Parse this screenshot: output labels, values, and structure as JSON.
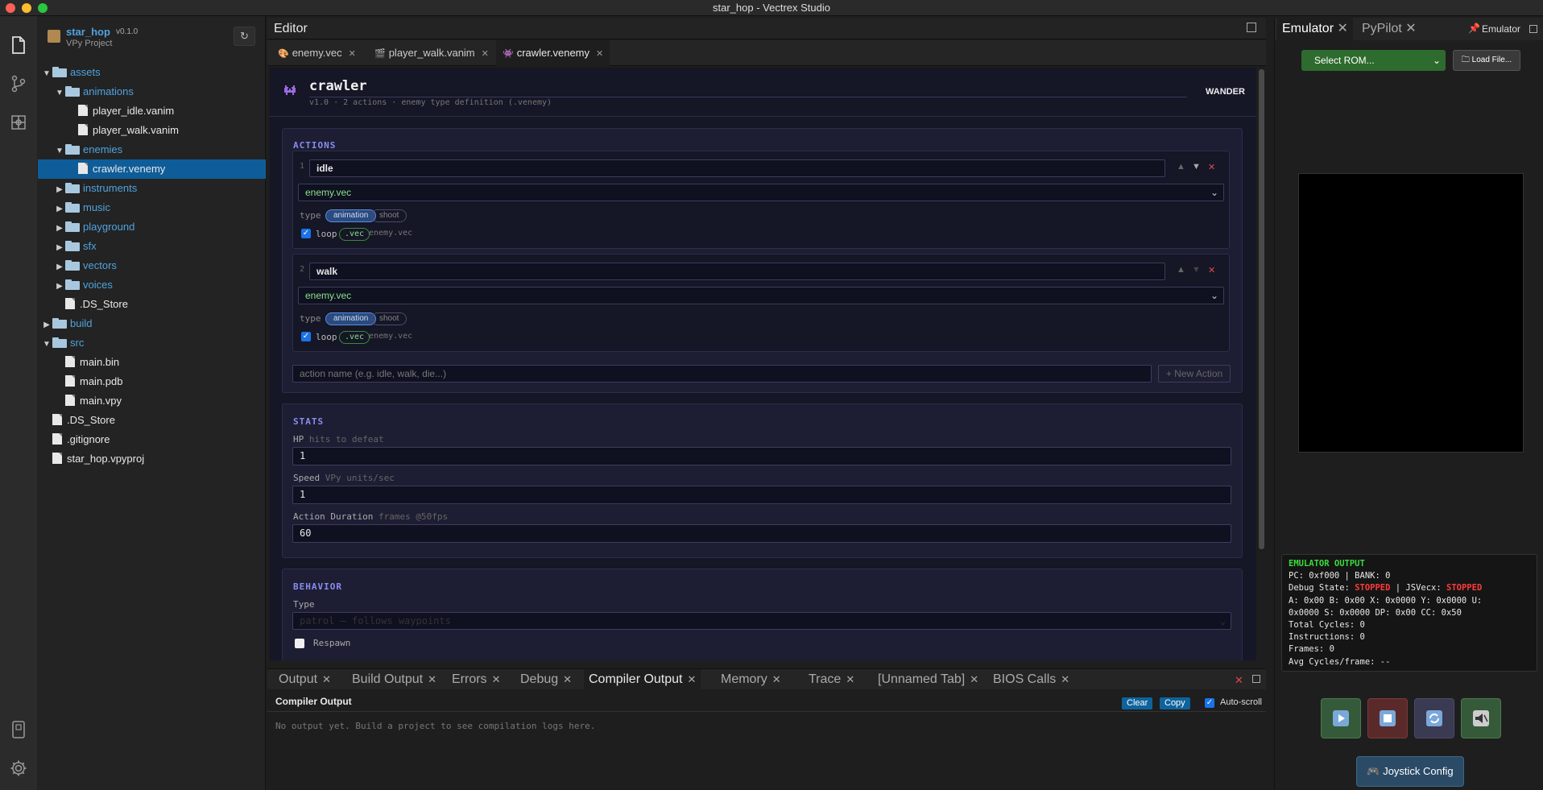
{
  "window": {
    "title": "star_hop - Vectrex Studio"
  },
  "project": {
    "name": "star_hop",
    "version": "v0.1.0",
    "subtitle": "VPy Project",
    "refresh_icon": "↻"
  },
  "tree": [
    {
      "label": "assets",
      "kind": "folder",
      "open": true,
      "depth": 0,
      "color": "blue"
    },
    {
      "label": "animations",
      "kind": "folder",
      "open": true,
      "depth": 1,
      "color": "blue"
    },
    {
      "label": "player_idle.vanim",
      "kind": "file",
      "depth": 2
    },
    {
      "label": "player_walk.vanim",
      "kind": "file",
      "depth": 2
    },
    {
      "label": "enemies",
      "kind": "folder",
      "open": true,
      "depth": 1,
      "color": "blue"
    },
    {
      "label": "crawler.venemy",
      "kind": "file",
      "depth": 2,
      "selected": true
    },
    {
      "label": "instruments",
      "kind": "folder",
      "open": false,
      "depth": 1,
      "color": "blue"
    },
    {
      "label": "music",
      "kind": "folder",
      "open": false,
      "depth": 1,
      "color": "blue"
    },
    {
      "label": "playground",
      "kind": "folder",
      "open": false,
      "depth": 1,
      "color": "blue"
    },
    {
      "label": "sfx",
      "kind": "folder",
      "open": false,
      "depth": 1,
      "color": "blue"
    },
    {
      "label": "vectors",
      "kind": "folder",
      "open": false,
      "depth": 1,
      "color": "blue"
    },
    {
      "label": "voices",
      "kind": "folder",
      "open": false,
      "depth": 1,
      "color": "blue"
    },
    {
      "label": ".DS_Store",
      "kind": "file",
      "depth": 1
    },
    {
      "label": "build",
      "kind": "folder",
      "open": false,
      "depth": 0,
      "color": "blue"
    },
    {
      "label": "src",
      "kind": "folder",
      "open": true,
      "depth": 0,
      "color": "blue"
    },
    {
      "label": "main.bin",
      "kind": "file",
      "depth": 1
    },
    {
      "label": "main.pdb",
      "kind": "file",
      "depth": 1
    },
    {
      "label": "main.vpy",
      "kind": "file",
      "depth": 1
    },
    {
      "label": ".DS_Store",
      "kind": "file",
      "depth": 0
    },
    {
      "label": ".gitignore",
      "kind": "file",
      "depth": 0
    },
    {
      "label": "star_hop.vpyproj",
      "kind": "file",
      "depth": 0
    }
  ],
  "editor": {
    "label": "Editor",
    "tabs": [
      {
        "label": "enemy.vec"
      },
      {
        "label": "player_walk.vanim"
      },
      {
        "label": "crawler.venemy",
        "active": true
      }
    ]
  },
  "enemy": {
    "name": "crawler",
    "meta": "v1.0 · 2 actions · enemy type definition (.venemy)",
    "behavior_badge": "WANDER",
    "actions_title": "ACTIONS",
    "actions": [
      {
        "index": "1",
        "name": "idle",
        "vec": "enemy.vec",
        "type_label": "type",
        "types": [
          "animation",
          "shoot"
        ],
        "loop_label": "loop",
        "ext": ".vec",
        "file": "enemy.vec"
      },
      {
        "index": "2",
        "name": "walk",
        "vec": "enemy.vec",
        "type_label": "type",
        "types": [
          "animation",
          "shoot"
        ],
        "loop_label": "loop",
        "ext": ".vec",
        "file": "enemy.vec"
      }
    ],
    "new_action_placeholder": "action name (e.g. idle, walk, die...)",
    "new_action_button": "+ New Action",
    "stats_title": "STATS",
    "hp_label": "HP",
    "hp_hint": "hits to defeat",
    "hp_value": "1",
    "speed_label": "Speed",
    "speed_hint": "VPy units/sec",
    "speed_value": "1",
    "duration_label": "Action Duration",
    "duration_hint": "frames @50fps",
    "duration_value": "60",
    "behavior_title": "BEHAVIOR",
    "behavior_type_label": "Type",
    "behavior_type_value": "patrol — follows waypoints",
    "respawn_label": "Respawn"
  },
  "bottom": {
    "tabs": [
      {
        "label": "Output"
      },
      {
        "label": "Build Output"
      },
      {
        "label": "Errors"
      },
      {
        "label": "Debug"
      },
      {
        "label": "Compiler Output",
        "active": true
      },
      {
        "label": "Memory"
      },
      {
        "label": "Trace"
      },
      {
        "label": "[Unnamed Tab]"
      },
      {
        "label": "BIOS Calls"
      }
    ],
    "title": "Compiler Output",
    "clear": "Clear",
    "copy": "Copy",
    "autoscroll": "Auto-scroll",
    "empty": "No output yet. Build a project to see compilation logs here."
  },
  "right": {
    "tabs": [
      {
        "label": "Emulator",
        "active": true
      },
      {
        "label": "PyPilot"
      }
    ],
    "pin_label": "Emulator",
    "rom_select": "Select ROM...",
    "load_file": "Load File...",
    "output_title": "EMULATOR OUTPUT",
    "pc_line": "PC: 0xf000 | BANK: 0",
    "debug_label": "Debug State:",
    "debug_state": "STOPPED",
    "jsvecx_label": "| JSVecx:",
    "jsvecx_state": "STOPPED",
    "regs1": "A: 0x00 B: 0x00 X: 0x0000 Y: 0x0000 U:",
    "regs2": "0x0000 S: 0x0000 DP: 0x00 CC: 0x50",
    "cycles": "Total Cycles: 0",
    "instructions": "Instructions: 0",
    "frames": "Frames: 0",
    "avg": "Avg Cycles/frame: --",
    "joystick": "Joystick Config"
  }
}
